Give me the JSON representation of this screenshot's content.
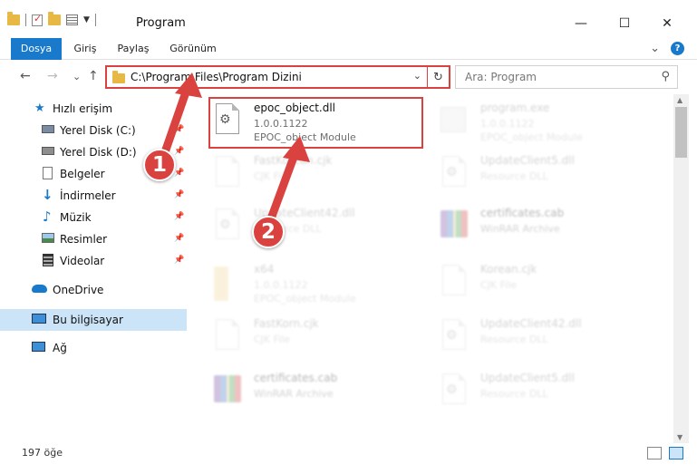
{
  "window": {
    "title": "Program",
    "minimize": "—",
    "maximize": "☐",
    "close": "✕"
  },
  "ribbon": {
    "tabs": [
      "Dosya",
      "Giriş",
      "Paylaş",
      "Görünüm"
    ],
    "expand": "⌄",
    "help": "?"
  },
  "nav": {
    "back": "←",
    "forward": "→",
    "recent": "⌄",
    "up": "↑",
    "address": "C:\\Program Files\\Program Dizini",
    "address_chevron": "⌄",
    "refresh": "↻",
    "search_placeholder": "Ara: Program",
    "search_icon": "search-icon"
  },
  "sidebar": {
    "items": [
      {
        "label": "Hızlı erişim",
        "icon": "star-icon",
        "pinned": false
      },
      {
        "label": "Yerel Disk (C:)",
        "icon": "drive-icon",
        "pinned": true
      },
      {
        "label": "Yerel Disk (D:)",
        "icon": "drive-icon",
        "pinned": true
      },
      {
        "label": "Belgeler",
        "icon": "documents-icon",
        "pinned": true
      },
      {
        "label": "İndirmeler",
        "icon": "download-icon",
        "pinned": true
      },
      {
        "label": "Müzik",
        "icon": "music-icon",
        "pinned": true
      },
      {
        "label": "Resimler",
        "icon": "pictures-icon",
        "pinned": true
      },
      {
        "label": "Videolar",
        "icon": "video-icon",
        "pinned": true
      },
      {
        "label": "OneDrive",
        "icon": "cloud-icon",
        "pinned": false
      },
      {
        "label": "Bu bilgisayar",
        "icon": "computer-icon",
        "pinned": false,
        "selected": true
      },
      {
        "label": "Ağ",
        "icon": "network-icon",
        "pinned": false
      }
    ],
    "pin_glyph": "📌"
  },
  "files": [
    {
      "name": "epoc_object.dll",
      "line2": "1.0.0.1122",
      "line3": "EPOC_object Module",
      "icon": "dll-icon",
      "highlighted": true
    },
    {
      "name": "program.exe",
      "line2": "1.0.0.1122",
      "line3": "EPOC_object Module",
      "icon": "exe-icon"
    },
    {
      "name": "FastKorean.cjk",
      "line2": "CJK File",
      "line3": "",
      "icon": "file-icon"
    },
    {
      "name": "UpdateClient5.dll",
      "line2": "Resource DLL",
      "line3": "",
      "icon": "dll-icon"
    },
    {
      "name": "UpdateClient42.dll",
      "line2": "Resource DLL",
      "line3": "",
      "icon": "dll-icon"
    },
    {
      "name": "certificates.cab",
      "line2": "WinRAR Archive",
      "line3": "",
      "icon": "archive-icon"
    },
    {
      "name": "x64",
      "line2": "1.0.0.1122",
      "line3": "EPOC_object Module",
      "icon": "folder-icon"
    },
    {
      "name": "Korean.cjk",
      "line2": "CJK File",
      "line3": "",
      "icon": "file-icon"
    },
    {
      "name": "FastKorn.cjk",
      "line2": "CJK File",
      "line3": "",
      "icon": "file-icon"
    },
    {
      "name": "UpdateClient42.dll",
      "line2": "Resource DLL",
      "line3": "",
      "icon": "dll-icon"
    },
    {
      "name": "certificates.cab",
      "line2": "WinRAR Archive",
      "line3": "",
      "icon": "archive-icon"
    },
    {
      "name": "UpdateClient5.dll",
      "line2": "Resource DLL",
      "line3": "",
      "icon": "dll-icon"
    }
  ],
  "status": {
    "count": "197 öğe"
  },
  "annotations": {
    "step1": "1",
    "step2": "2",
    "color": "#d9423e"
  },
  "colors": {
    "accent": "#1979ca",
    "selection": "#cce4f7",
    "annotation": "#d9423e"
  }
}
